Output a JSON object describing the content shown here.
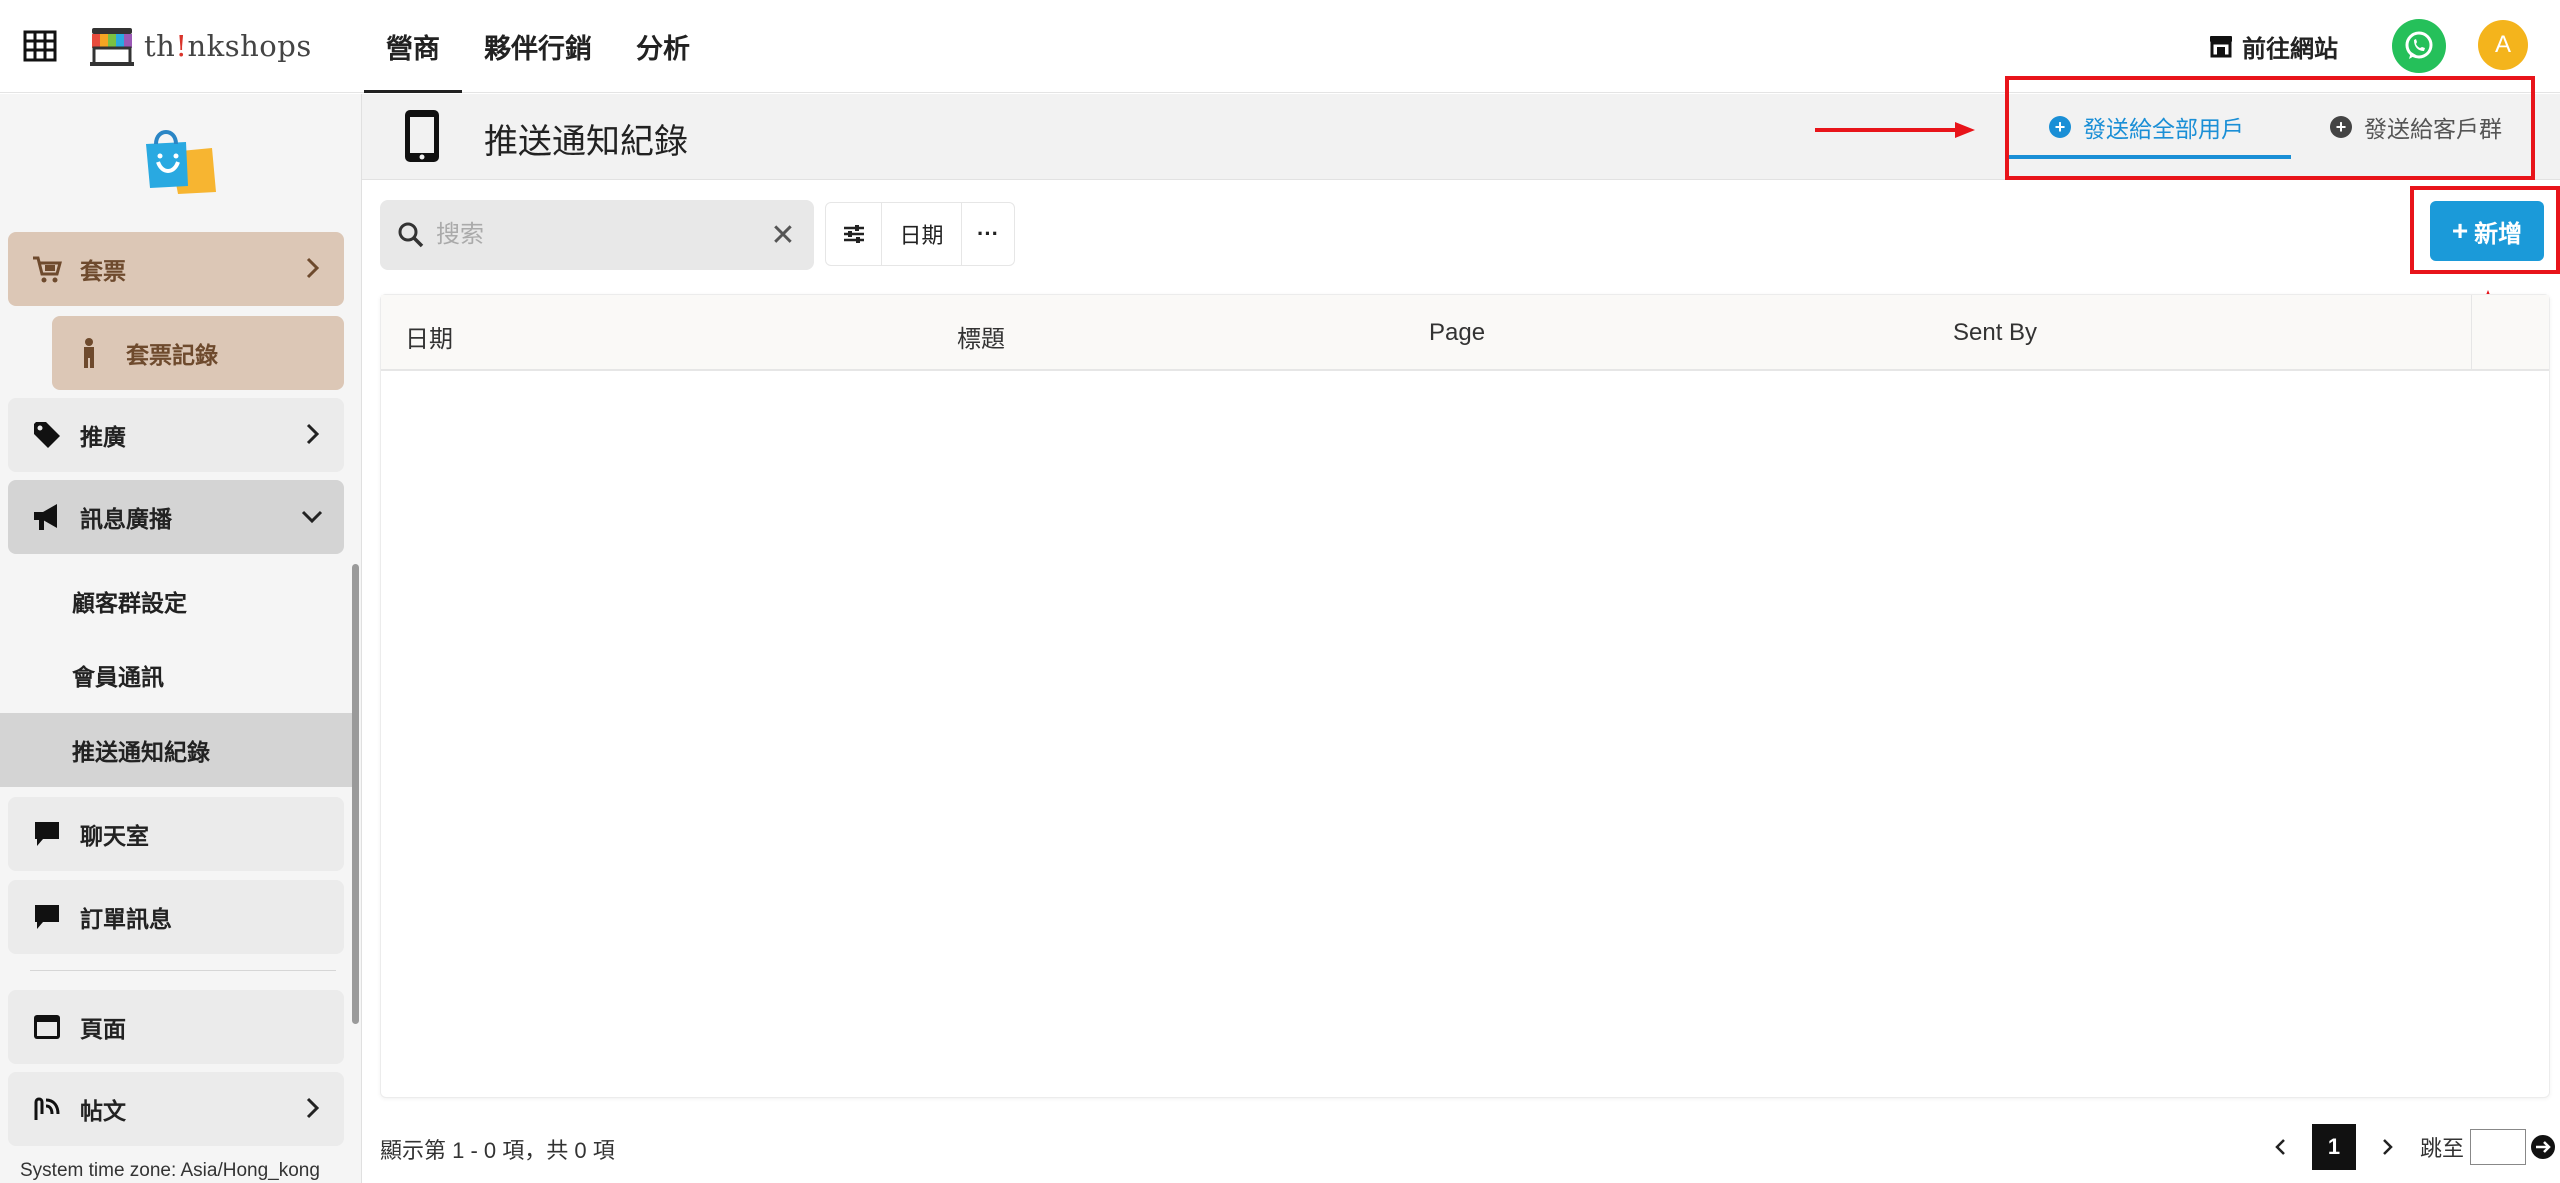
{
  "app": {
    "logo_prefix": "th",
    "logo_excl": "!",
    "logo_suffix": "nkshops"
  },
  "top_nav": [
    {
      "label": "營商",
      "active": true
    },
    {
      "label": "夥伴行銷",
      "active": false
    },
    {
      "label": "分析",
      "active": false
    }
  ],
  "header_right": {
    "goto_site_label": "前往網站",
    "avatar_initial": "A"
  },
  "sidebar": {
    "ticket_label": "套票",
    "ticket_record_label": "套票記錄",
    "promotion_label": "推廣",
    "broadcast_label": "訊息廣播",
    "broadcast_sub": [
      {
        "label": "顧客群設定",
        "active": false
      },
      {
        "label": "會員通訊",
        "active": false
      },
      {
        "label": "推送通知紀錄",
        "active": true
      }
    ],
    "chat_label": "聊天室",
    "order_msg_label": "訂單訊息",
    "page_label": "頁面",
    "post_label": "帖文",
    "timezone_text": "System time zone: Asia/Hong_kong"
  },
  "page_header": {
    "title": "推送通知紀錄",
    "tabs": [
      {
        "label": "發送給全部用戶",
        "active": true
      },
      {
        "label": "發送給客戶群",
        "active": false
      }
    ]
  },
  "toolbar": {
    "search_placeholder": "搜索",
    "clear_symbol": "✕",
    "date_filter_label": "日期",
    "more_symbol": "···",
    "add_label": "新增",
    "add_symbol": "+"
  },
  "table": {
    "columns": [
      "日期",
      "標題",
      "Page",
      "Sent By"
    ],
    "rows": []
  },
  "pagination": {
    "summary": "顯示第 1 - 0 項，共 0 項",
    "current_page": "1",
    "jump_label": "跳至"
  },
  "colors": {
    "accent_blue": "#1b9ad9",
    "annotation_red": "#e8141a",
    "ticket_brown": "#dcc7b6",
    "whatsapp_green": "#25c05a",
    "avatar_yellow": "#f4b41c"
  }
}
